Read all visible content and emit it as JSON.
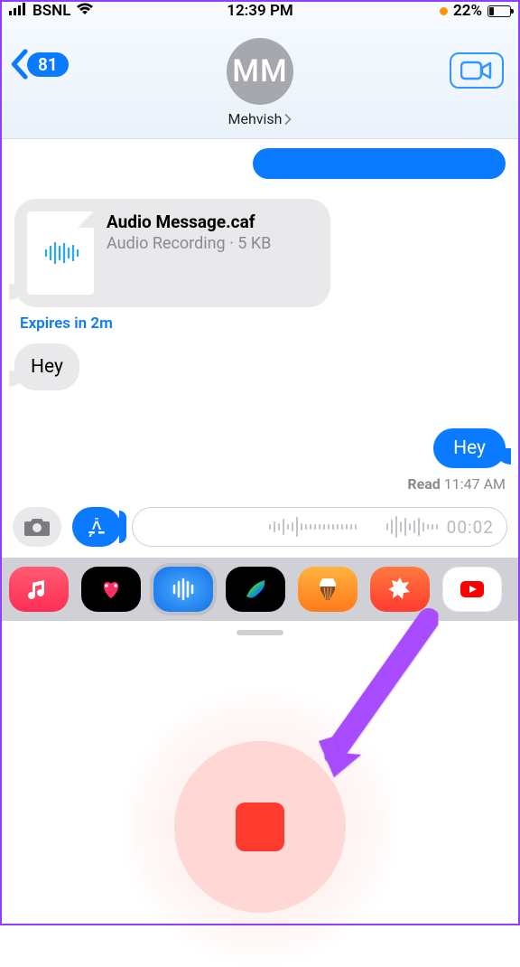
{
  "status": {
    "carrier": "BSNL",
    "time": "12:39 PM",
    "battery_pct": "22%"
  },
  "nav": {
    "back_count": "81",
    "avatar_initials": "MM",
    "contact_name": "Mehvish"
  },
  "messages": {
    "attachment": {
      "title": "Audio Message.caf",
      "subtitle": "Audio Recording · 5 KB"
    },
    "expires": "Expires in 2m",
    "incoming1": "Hey",
    "outgoing1": "Hey",
    "read_label": "Read",
    "read_time": "11:47 AM"
  },
  "input": {
    "rec_time": "00:02"
  },
  "apps": {
    "music": "music-app-icon",
    "heart": "digital-touch-icon",
    "wave": "audio-wave-icon",
    "brush": "brush-app-icon",
    "garageband": "garageband-icon",
    "clips": "clips-icon",
    "youtube": "youtube-icon"
  }
}
